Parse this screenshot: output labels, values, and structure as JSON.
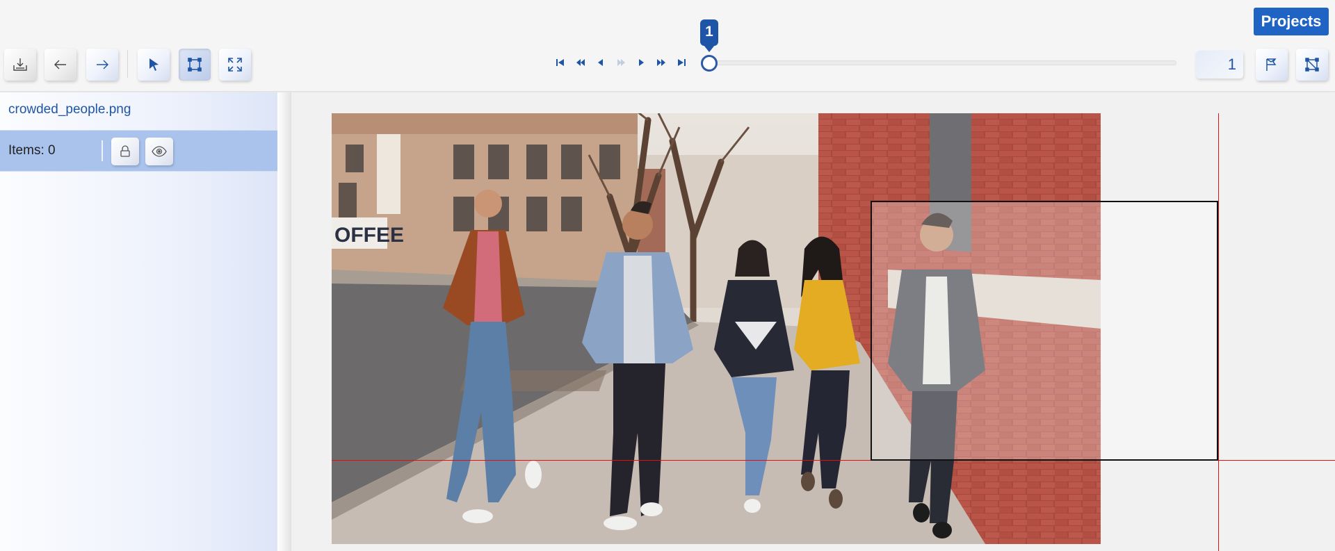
{
  "toolbar": {
    "projects_label": "Projects",
    "frame_number": "1",
    "slider_value": "1",
    "slider_progress": 0.0,
    "buttons": [
      "save-icon",
      "undo-icon",
      "redo-icon",
      "cursor-icon",
      "rectangle-tool-icon",
      "fit-screen-icon"
    ],
    "right_buttons": [
      "flag-icon",
      "no-annotation-icon"
    ],
    "player": [
      "first-frame-icon",
      "fast-backward-icon",
      "previous-icon",
      "play-icon",
      "next-icon",
      "fast-forward-icon",
      "last-frame-icon"
    ]
  },
  "sidebar": {
    "file_name": "crowded_people.png",
    "items_label": "Items: 0",
    "lock_icon": "lock-icon",
    "eye_icon": "eye-icon"
  },
  "colors": {
    "accent": "#1f55a6",
    "projects_bg": "#1f63c4",
    "items_row_bg": "#a9c3ec",
    "crosshair": "#e01010",
    "bbox_border": "#111111"
  }
}
